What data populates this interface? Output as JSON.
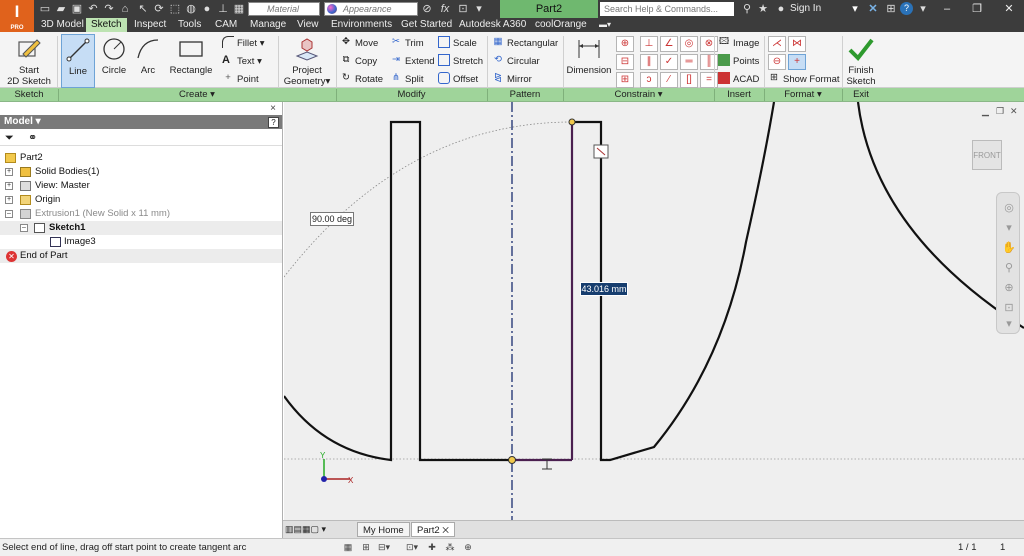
{
  "titlebar": {
    "material_placeholder": "Material",
    "appearance_placeholder": "Appearance",
    "fx_label": "fx",
    "document_title": "Part2",
    "search_placeholder": "Search Help & Commands...",
    "signin_label": "Sign In",
    "logo_letter": "I",
    "logo_sub": "PRO"
  },
  "tabs": [
    {
      "label": "3D Model"
    },
    {
      "label": "Sketch",
      "active": true
    },
    {
      "label": "Inspect"
    },
    {
      "label": "Tools"
    },
    {
      "label": "CAM"
    },
    {
      "label": "Manage"
    },
    {
      "label": "View"
    },
    {
      "label": "Environments"
    },
    {
      "label": "Get Started"
    },
    {
      "label": "Autodesk A360"
    },
    {
      "label": "coolOrange"
    }
  ],
  "ribbon": {
    "sketch": {
      "start_sketch_line1": "Start",
      "start_sketch_line2": "2D Sketch"
    },
    "create": {
      "line": "Line",
      "circle": "Circle",
      "arc": "Arc",
      "rectangle": "Rectangle",
      "fillet": "Fillet",
      "text": "Text",
      "point": "Point",
      "project_geometry_line1": "Project",
      "project_geometry_line2": "Geometry"
    },
    "modify": {
      "move": "Move",
      "copy": "Copy",
      "rotate": "Rotate",
      "trim": "Trim",
      "extend": "Extend",
      "split": "Split",
      "scale": "Scale",
      "stretch": "Stretch",
      "offset": "Offset"
    },
    "pattern": {
      "rectangular": "Rectangular",
      "circular": "Circular",
      "mirror": "Mirror"
    },
    "constrain": {
      "dimension": "Dimension"
    },
    "insert": {
      "image": "Image",
      "points": "Points",
      "acad": "ACAD"
    },
    "format": {
      "show_format": "Show Format"
    },
    "exit": {
      "finish_line1": "Finish",
      "finish_line2": "Sketch"
    }
  },
  "panels": [
    {
      "label": "Sketch"
    },
    {
      "label": "Create",
      "dropdown": true
    },
    {
      "label": "Modify"
    },
    {
      "label": "Pattern"
    },
    {
      "label": "Constrain",
      "dropdown": true
    },
    {
      "label": "Insert"
    },
    {
      "label": "Format",
      "dropdown": true
    },
    {
      "label": "Exit"
    }
  ],
  "browser": {
    "title": "Model",
    "help_glyph": "?",
    "close_glyph": "×",
    "tree": [
      {
        "label": "Part2"
      },
      {
        "label": "Solid Bodies(1)"
      },
      {
        "label": "View: Master"
      },
      {
        "label": "Origin"
      },
      {
        "label": "Extrusion1 (New Solid x 11 mm)"
      },
      {
        "label": "Sketch1"
      },
      {
        "label": "Image3"
      },
      {
        "label": "End of Part"
      }
    ]
  },
  "canvas": {
    "angle_dimension": "90.00 deg",
    "length_dimension": "43.016 mm",
    "viewcube_face": "FRONT",
    "axis_x_label": "X",
    "axis_y_label": "Y"
  },
  "doc_tabs": [
    {
      "label": "My Home"
    },
    {
      "label": "Part2",
      "active": true
    }
  ],
  "status": {
    "message": "Select end of line, drag off start point to create tangent arc",
    "page": "1 / 1",
    "count": "1"
  },
  "colors": {
    "ribbon_panel_bar": "#9fd49a",
    "active_tab": "#bde3b2",
    "title_bar": "#3c3c3c",
    "document_title_bg": "#6fb86f",
    "sketch_line": "#111111",
    "centerline": "#1a2d6e",
    "selected_line": "#4a1f4f"
  }
}
